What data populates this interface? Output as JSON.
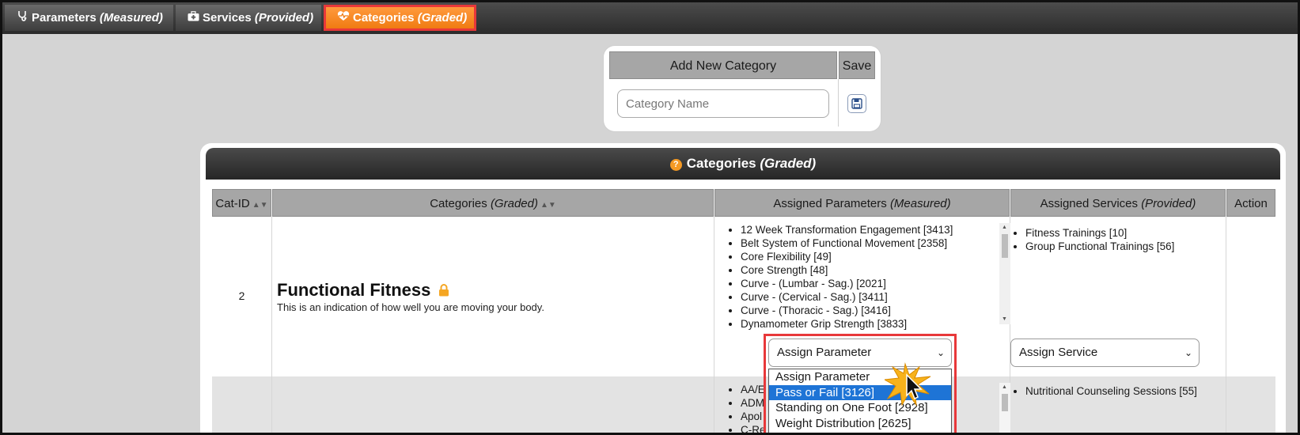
{
  "tabs": [
    {
      "label": "Parameters",
      "qualifier": "(Measured)",
      "icon": "stethoscope-icon",
      "active": false
    },
    {
      "label": "Services",
      "qualifier": "(Provided)",
      "icon": "medical-kit-icon",
      "active": false
    },
    {
      "label": "Categories",
      "qualifier": "(Graded)",
      "icon": "heart-pulse-icon",
      "active": true
    }
  ],
  "add_category": {
    "header_name": "Add New Category",
    "header_save": "Save",
    "input_placeholder": "Category Name",
    "input_value": ""
  },
  "panel": {
    "title": "Categories",
    "title_qualifier": "(Graded)",
    "columns": [
      {
        "label": "Cat-ID",
        "qualifier": "",
        "sortable": true
      },
      {
        "label": "Categories",
        "qualifier": "(Graded)",
        "sortable": true
      },
      {
        "label": "Assigned Parameters",
        "qualifier": "(Measured)",
        "sortable": false
      },
      {
        "label": "Assigned Services",
        "qualifier": "(Provided)",
        "sortable": false
      },
      {
        "label": "Action",
        "qualifier": "",
        "sortable": false
      }
    ]
  },
  "rows": [
    {
      "id": "2",
      "name": "Functional Fitness",
      "locked": true,
      "description": "This is an indication of how well you are moving your body.",
      "parameters": [
        "12 Week Transformation Engagement [3413]",
        "Belt System of Functional Movement [2358]",
        "Core Flexibility [49]",
        "Core Strength [48]",
        "Curve - (Lumbar - Sag.) [2021]",
        "Curve - (Cervical - Sag.) [3411]",
        "Curve - (Thoracic - Sag.) [3416]",
        "Dynamometer Grip Strength [3833]"
      ],
      "services": [
        "Fitness Trainings [10]",
        "Group Functional Trainings [56]"
      ],
      "assign_parameter": "Assign Parameter",
      "assign_service": "Assign Service",
      "dropdown_options": [
        "Assign Parameter",
        "Pass or Fail [3126]",
        "Standing on One Foot [2928]",
        "Weight Distribution [2625]"
      ],
      "dropdown_selected_index": 1
    },
    {
      "parameters": [
        "AA/E",
        "ADM",
        "Apol",
        "C-Re"
      ],
      "services": [
        "Nutritional Counseling Sessions [55]"
      ]
    }
  ],
  "colors": {
    "active_tab": "#f07b12",
    "highlight_border": "#e8383a",
    "selected_option": "#1e74d6",
    "lock": "#f5a623"
  }
}
